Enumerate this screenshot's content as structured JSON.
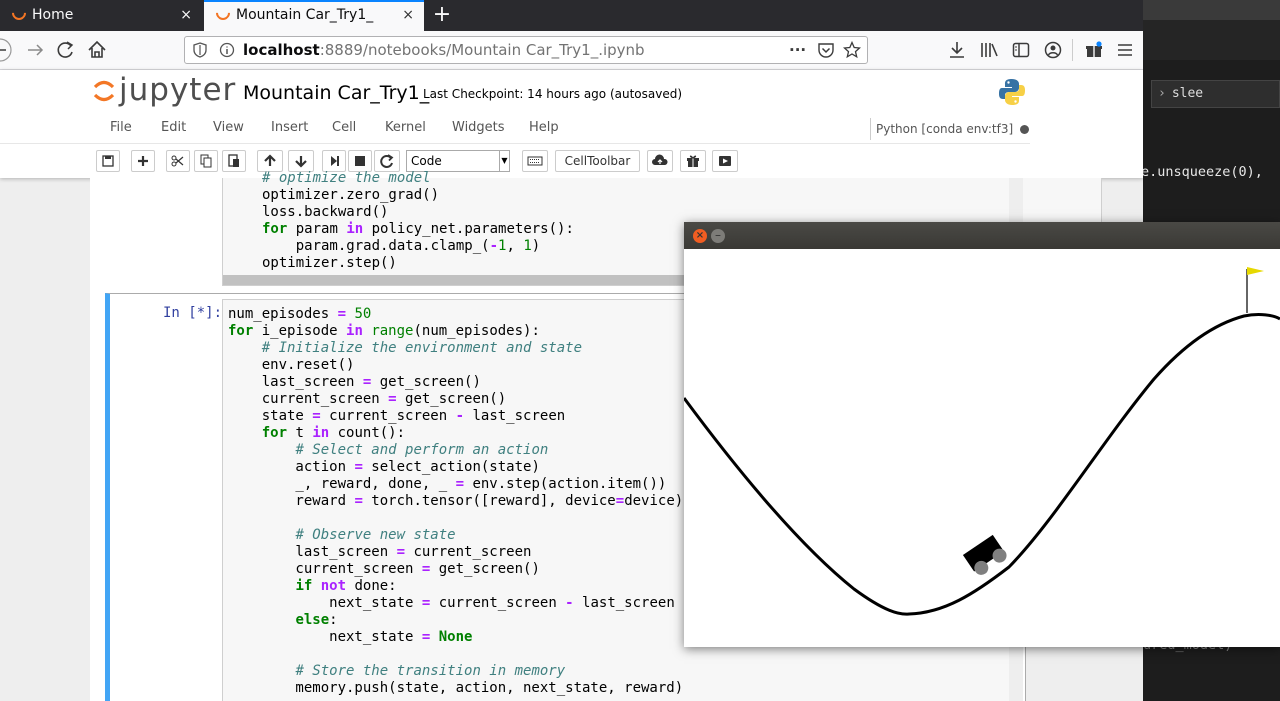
{
  "browser": {
    "tabs": [
      {
        "label": "Home",
        "close": "×"
      },
      {
        "label": "Mountain Car_Try1_",
        "close": "×"
      }
    ],
    "new_tab": "+",
    "url": {
      "host": "localhost",
      "rest": ":8889/notebooks/Mountain Car_Try1_.ipynb"
    },
    "url_menu": "···"
  },
  "jupyter": {
    "logo_text": "jupyter",
    "notebook_title": "Mountain Car_Try1_",
    "checkpoint": "Last Checkpoint: 14 hours ago (autosaved)",
    "menu": [
      "File",
      "Edit",
      "View",
      "Insert",
      "Cell",
      "Kernel",
      "Widgets",
      "Help"
    ],
    "kernel": "Python [conda env:tf3]",
    "toolbar": {
      "cell_type": "Code",
      "celltoolbar": "CellToolbar"
    }
  },
  "cell1": {
    "lines": [
      "# optimize the model",
      "optimizer.zero_grad()",
      "loss.backward()",
      "for param in policy_net.parameters():",
      "    param.grad.data.clamp_(-1, 1)",
      "optimizer.step()"
    ]
  },
  "cell2": {
    "prompt": "In [*]:"
  },
  "terminal": {
    "search_text": "slee",
    "code_line": "e.unsqueeze(0),",
    "code_line2": "ured_model)"
  },
  "colors": {
    "jupyter_orange": "#f37726",
    "firefox_blue": "#0a84ff",
    "cell_selected": "#42a5f5",
    "ubuntu_close": "#f15d22"
  }
}
